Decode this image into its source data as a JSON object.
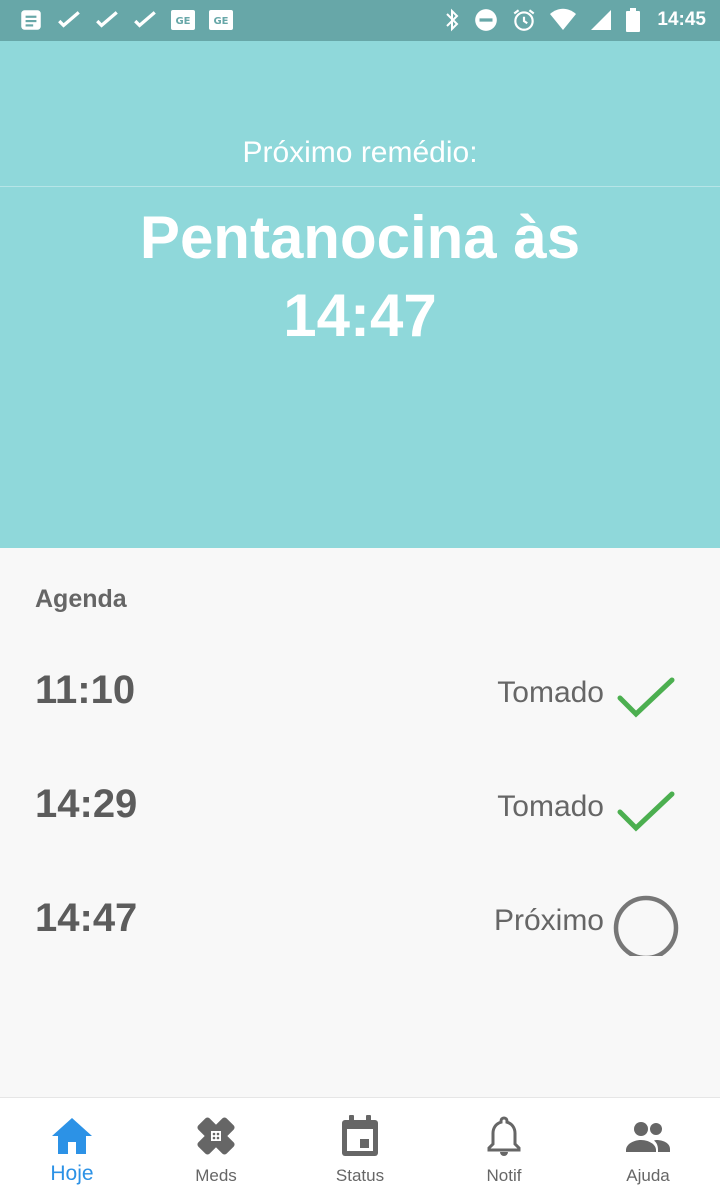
{
  "status_bar": {
    "time": "14:45",
    "left_icons": [
      "message-icon",
      "check-icon",
      "check-icon",
      "check-icon",
      "ge-icon",
      "ge-icon"
    ],
    "right_icons": [
      "bluetooth-icon",
      "do-not-disturb-icon",
      "alarm-icon",
      "wifi-icon",
      "signal-icon",
      "battery-icon"
    ]
  },
  "hero": {
    "label": "Próximo remédio:",
    "title": "Pentanocina às 14:47"
  },
  "agenda": {
    "title": "Agenda",
    "items": [
      {
        "time": "11:10",
        "status": "Tomado",
        "icon": "check-icon",
        "state": "taken"
      },
      {
        "time": "14:29",
        "status": "Tomado",
        "icon": "check-icon",
        "state": "taken"
      },
      {
        "time": "14:47",
        "status": "Próximo",
        "icon": "circle-icon",
        "state": "next"
      }
    ]
  },
  "nav": {
    "items": [
      {
        "label": "Hoje",
        "icon": "home-icon",
        "active": true
      },
      {
        "label": "Meds",
        "icon": "bandage-icon",
        "active": false
      },
      {
        "label": "Status",
        "icon": "calendar-icon",
        "active": false
      },
      {
        "label": "Notif",
        "icon": "bell-icon",
        "active": false
      },
      {
        "label": "Ajuda",
        "icon": "people-icon",
        "active": false
      }
    ]
  },
  "colors": {
    "status_bar": "#67a7a8",
    "hero": "#8fd8da",
    "check": "#4caf50",
    "active": "#2c92e6",
    "inactive_icon": "#666666"
  }
}
